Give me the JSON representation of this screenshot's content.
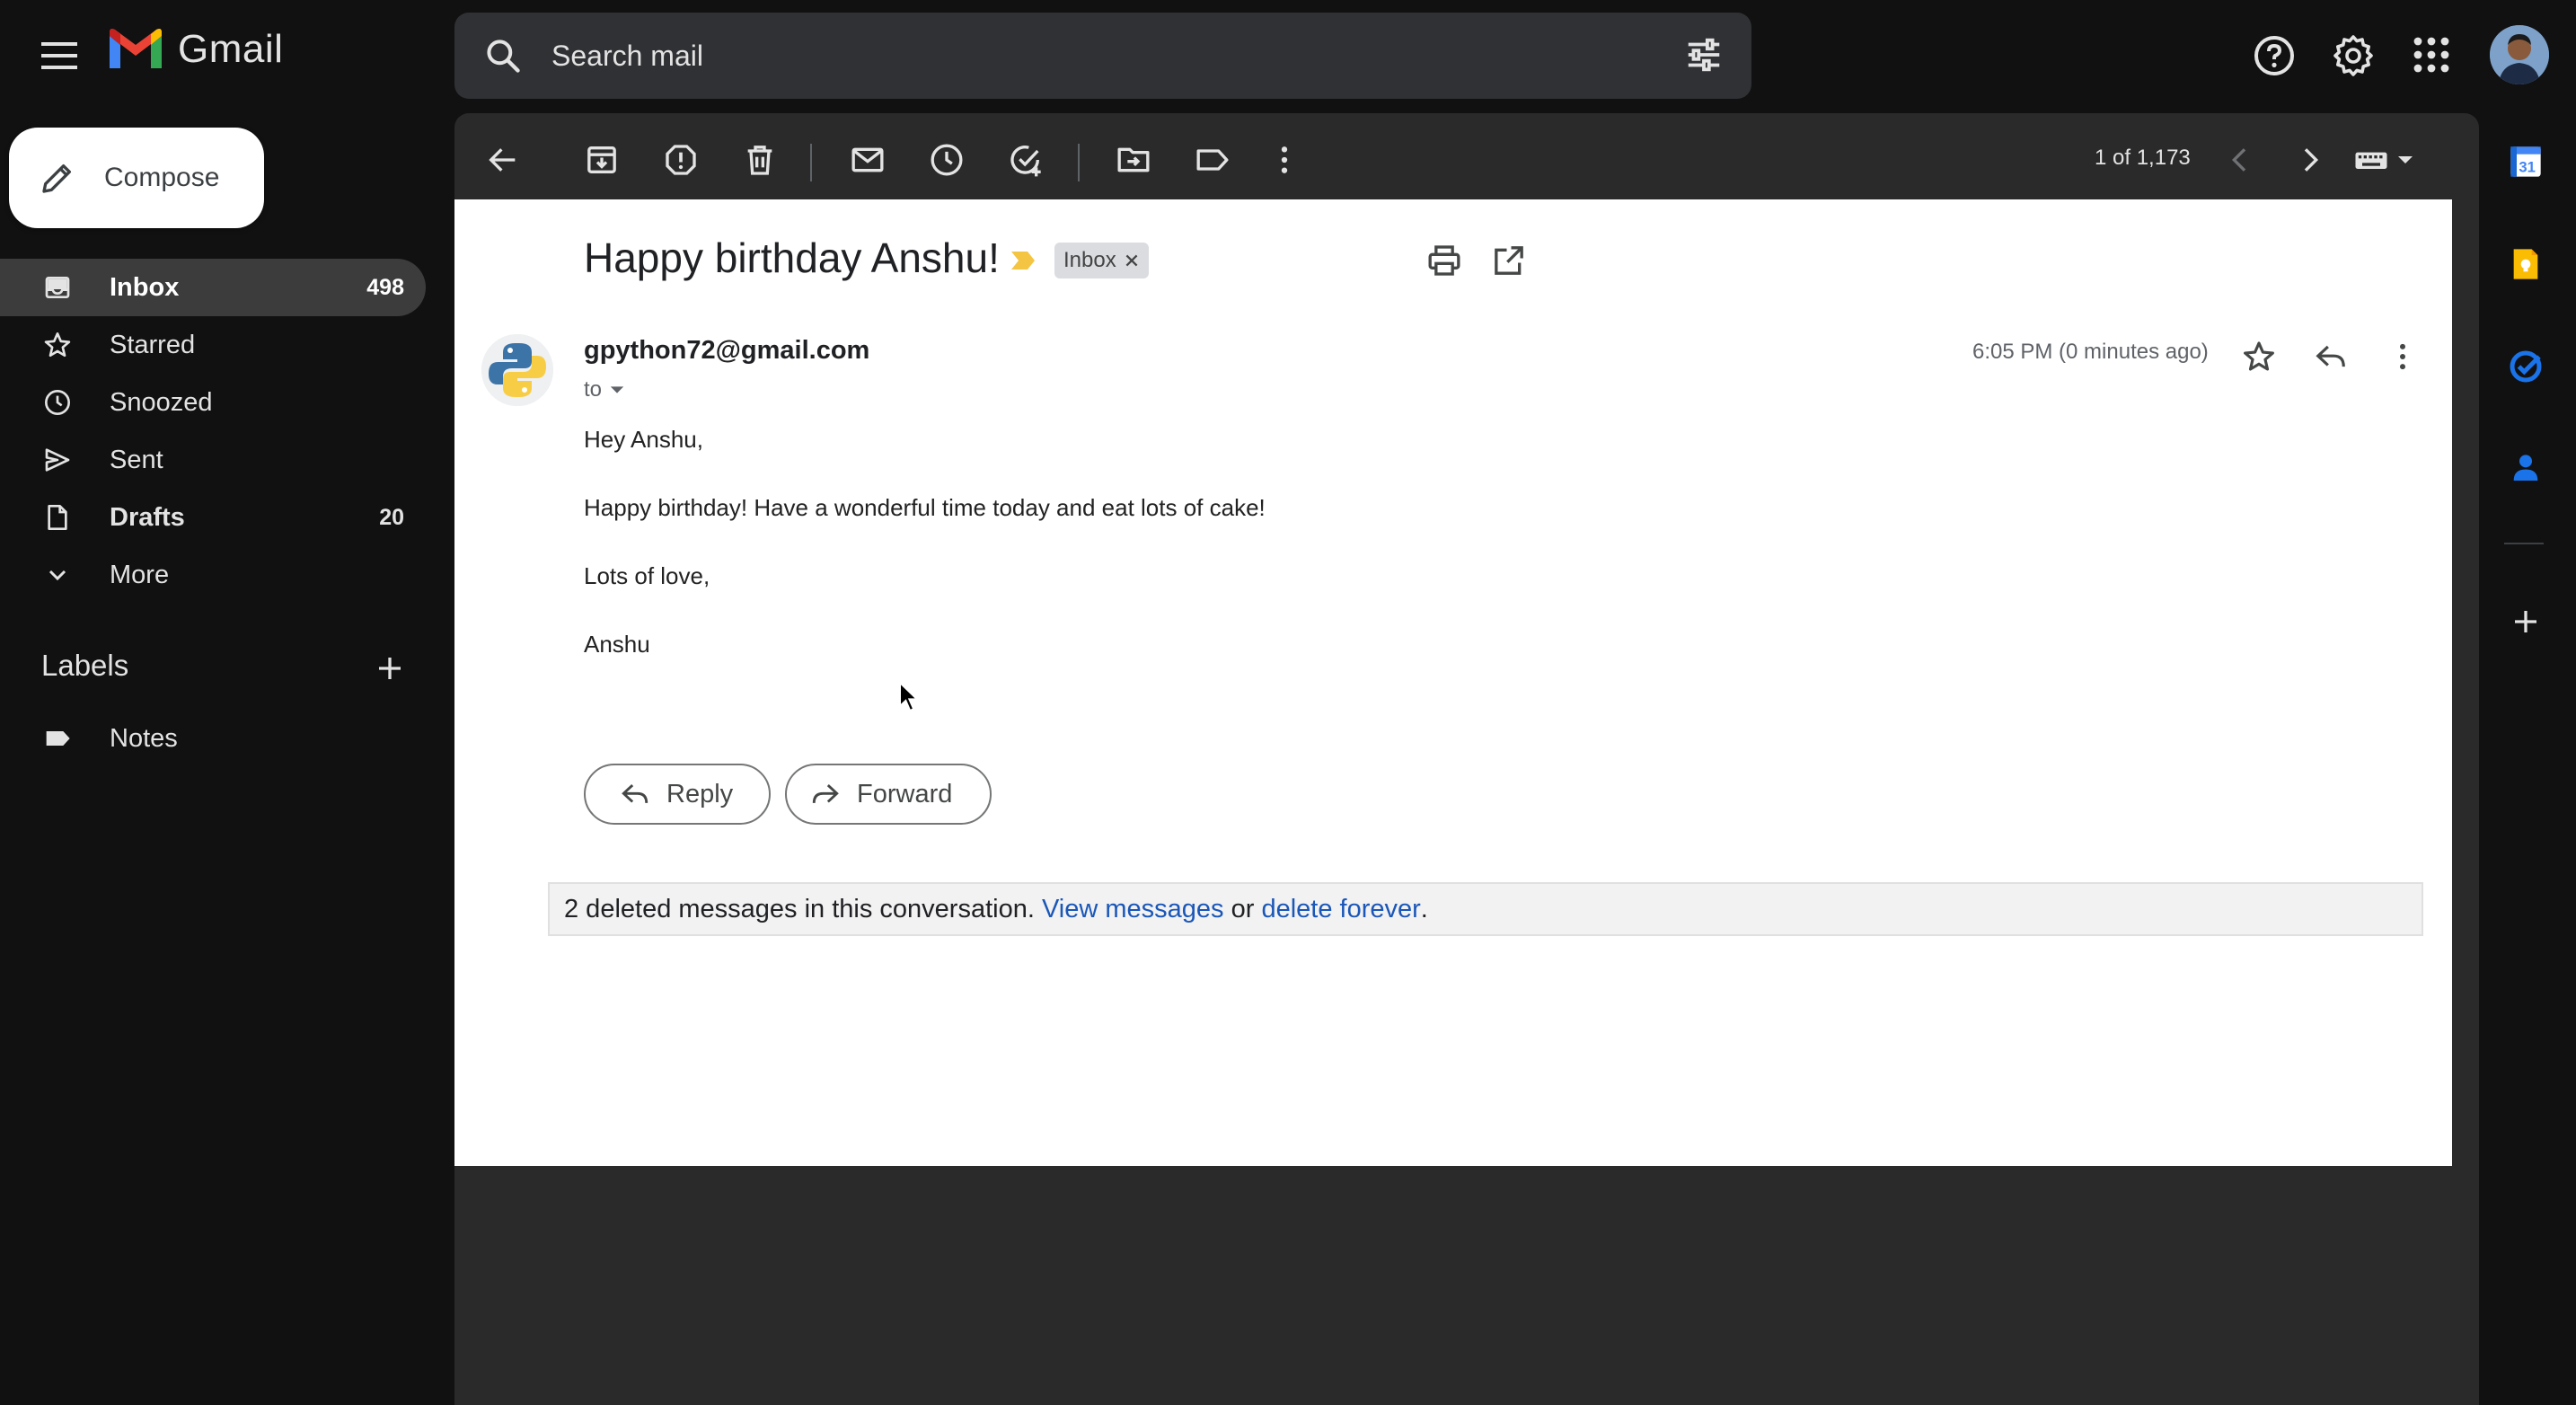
{
  "app": {
    "name": "Gmail"
  },
  "search": {
    "placeholder": "Search mail"
  },
  "compose": {
    "label": "Compose"
  },
  "nav": {
    "items": [
      {
        "label": "Inbox",
        "count": "498",
        "icon": "inbox-icon"
      },
      {
        "label": "Starred",
        "count": "",
        "icon": "star-icon"
      },
      {
        "label": "Snoozed",
        "count": "",
        "icon": "clock-icon"
      },
      {
        "label": "Sent",
        "count": "",
        "icon": "send-icon"
      },
      {
        "label": "Drafts",
        "count": "20",
        "icon": "draft-icon"
      },
      {
        "label": "More",
        "count": "",
        "icon": "chevron-down-icon"
      }
    ]
  },
  "labels": {
    "heading": "Labels",
    "items": [
      {
        "label": "Notes",
        "icon": "label-icon"
      }
    ]
  },
  "toolbar": {
    "counter": "1 of 1,173"
  },
  "email": {
    "subject": "Happy birthday Anshu!",
    "chip": "Inbox",
    "sender": "gpython72@gmail.com",
    "to": "to",
    "time": "6:05 PM (0 minutes ago)",
    "body": [
      "Hey Anshu,",
      "Happy birthday! Have a wonderful time today and eat lots of cake!",
      "Lots of love,",
      "Anshu"
    ],
    "reply_label": "Reply",
    "forward_label": "Forward",
    "deleted_notice": {
      "text": "2 deleted messages in this conversation.",
      "view_link": "View messages",
      "or": "or",
      "delete_link": "delete forever",
      "end": "."
    }
  },
  "colors": {
    "background": "#111111",
    "panel": "#2a2a2a",
    "search": "#303134",
    "link": "#1a57b8",
    "important": "#f4c542"
  }
}
